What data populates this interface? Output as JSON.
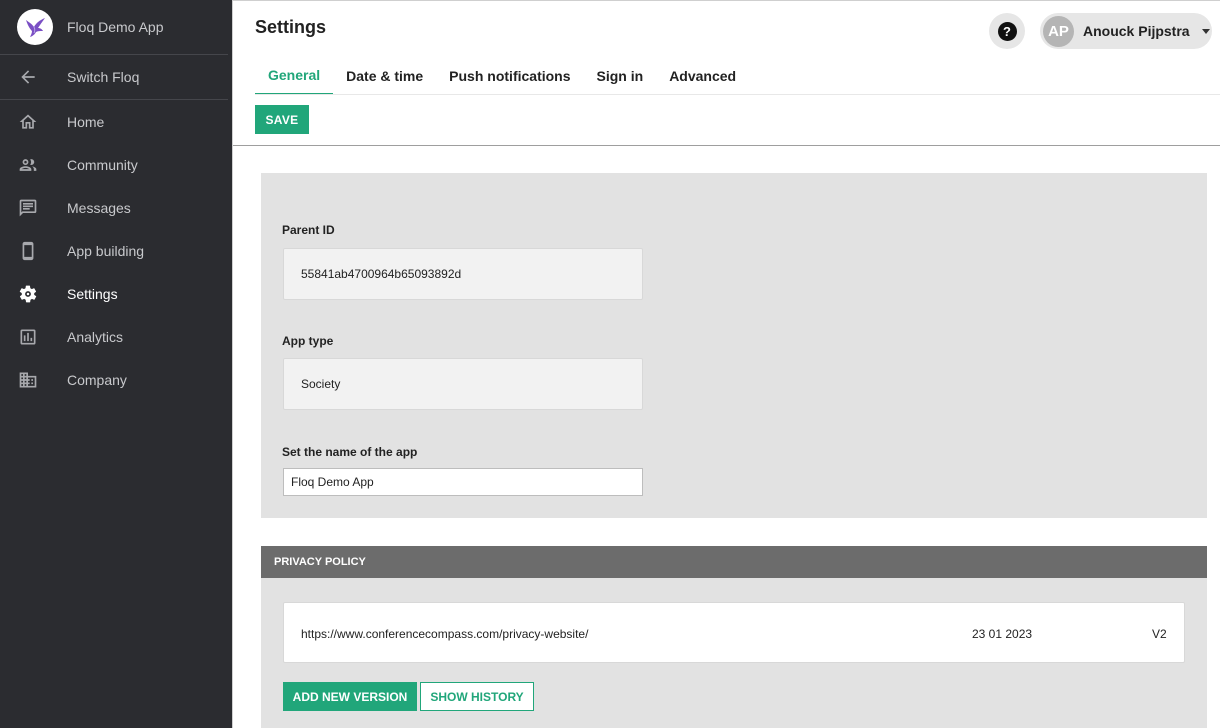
{
  "sidebar": {
    "app_name": "Floq Demo App",
    "switch_label": "Switch Floq",
    "items": [
      {
        "label": "Home",
        "icon": "home-icon"
      },
      {
        "label": "Community",
        "icon": "people-icon"
      },
      {
        "label": "Messages",
        "icon": "message-icon"
      },
      {
        "label": "App building",
        "icon": "phone-icon"
      },
      {
        "label": "Settings",
        "icon": "gear-icon"
      },
      {
        "label": "Analytics",
        "icon": "chart-icon"
      },
      {
        "label": "Company",
        "icon": "building-icon"
      }
    ],
    "active": "Settings"
  },
  "header": {
    "title": "Settings",
    "help_symbol": "?",
    "user": {
      "initials": "AP",
      "name": "Anouck Pijpstra"
    }
  },
  "tabs": [
    {
      "label": "General"
    },
    {
      "label": "Date & time"
    },
    {
      "label": "Push notifications"
    },
    {
      "label": "Sign in"
    },
    {
      "label": "Advanced"
    }
  ],
  "active_tab": "General",
  "toolbar": {
    "save_label": "SAVE"
  },
  "general": {
    "parent_id": {
      "label": "Parent ID",
      "value": "55841ab4700964b65093892d"
    },
    "app_type": {
      "label": "App type",
      "value": "Society"
    },
    "app_name": {
      "label": "Set the name of the app",
      "value": "Floq Demo App"
    }
  },
  "privacy_policy": {
    "header": "PRIVACY POLICY",
    "url": "https://www.conferencecompass.com/privacy-website/",
    "date": "23 01 2023",
    "version": "V2",
    "add_label": "ADD NEW VERSION",
    "history_label": "SHOW HISTORY"
  },
  "colors": {
    "accent": "#21a67a",
    "sidebar_bg": "#2b2c30",
    "section_header": "#6c6c6c"
  }
}
